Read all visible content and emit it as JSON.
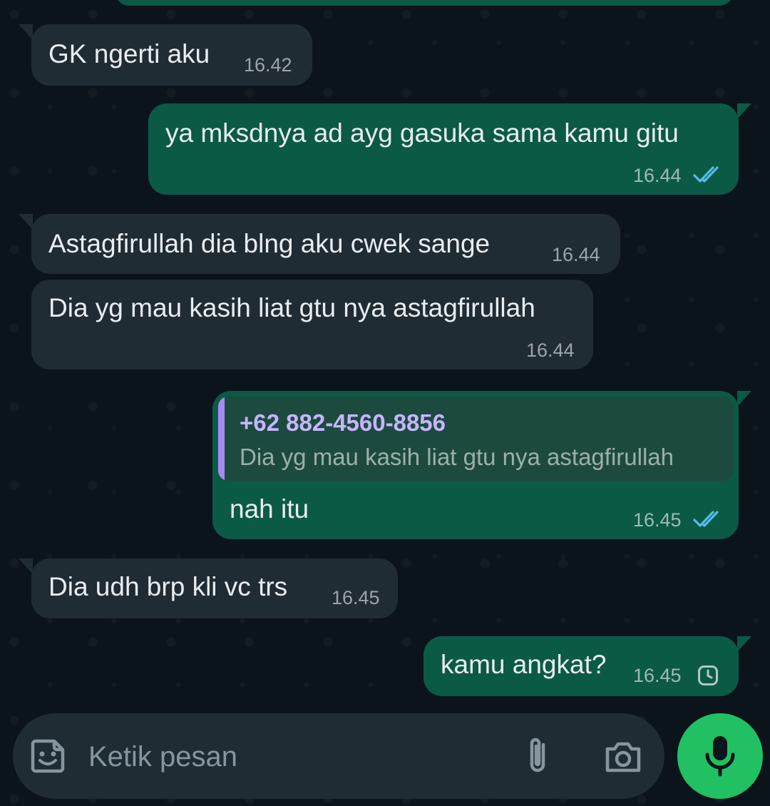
{
  "colors": {
    "background": "#0b141a",
    "incoming_bubble": "#202c33",
    "outgoing_bubble": "#0b5a46",
    "read_ticks": "#53bdeb",
    "quote_accent": "#a788f3",
    "mic_button": "#21c063"
  },
  "messages": [
    {
      "id": "m1",
      "direction": "in",
      "text": "GK ngerti aku",
      "time": "16.42"
    },
    {
      "id": "m2",
      "direction": "out",
      "text": "ya mksdnya ad ayg gasuka sama kamu gitu",
      "time": "16.44",
      "status": "read"
    },
    {
      "id": "m3",
      "direction": "in",
      "text": "Astagfirullah dia blng aku cwek sange",
      "time": "16.44"
    },
    {
      "id": "m4",
      "direction": "in",
      "text": "Dia yg mau kasih liat gtu nya astagfirullah",
      "time": "16.44"
    },
    {
      "id": "m5",
      "direction": "out",
      "text": "nah itu",
      "time": "16.45",
      "status": "read",
      "reply_to": {
        "author": "+62 882-4560-8856",
        "text": "Dia yg mau kasih liat gtu nya astagfirullah"
      }
    },
    {
      "id": "m6",
      "direction": "in",
      "text": "Dia udh brp kli vc trs",
      "time": "16.45"
    },
    {
      "id": "m7",
      "direction": "out",
      "text": "kamu angkat?",
      "time": "16.45",
      "status": "pending"
    }
  ],
  "composer": {
    "placeholder": "Ketik pesan",
    "emoji_icon": "sticker-icon",
    "attach_icon": "paperclip-icon",
    "camera_icon": "camera-icon",
    "mic_icon": "microphone-icon"
  }
}
